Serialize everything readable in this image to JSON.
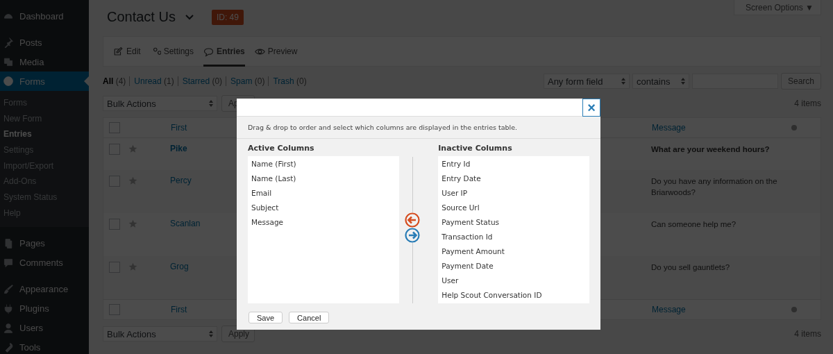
{
  "sidebar": {
    "groups": [
      [
        {
          "label": "Dashboard",
          "selected": false
        }
      ],
      [
        {
          "label": "Posts",
          "selected": false
        },
        {
          "label": "Media",
          "selected": false
        },
        {
          "label": "Forms",
          "selected": true,
          "children": [
            {
              "label": "Forms",
              "selected": false
            },
            {
              "label": "New Form",
              "selected": false
            },
            {
              "label": "Entries",
              "selected": true
            },
            {
              "label": "Settings",
              "selected": false
            },
            {
              "label": "Import/Export",
              "selected": false
            },
            {
              "label": "Add-Ons",
              "selected": false
            },
            {
              "label": "System Status",
              "selected": false
            },
            {
              "label": "Help",
              "selected": false
            }
          ]
        },
        {
          "label": "Pages",
          "selected": false
        },
        {
          "label": "Comments",
          "selected": false
        }
      ],
      [
        {
          "label": "Appearance",
          "selected": false
        },
        {
          "label": "Plugins",
          "selected": false
        },
        {
          "label": "Users",
          "selected": false
        },
        {
          "label": "Tools",
          "selected": false
        }
      ]
    ]
  },
  "screen_options": "Screen Options ▼",
  "header": {
    "title": "Contact Us",
    "badge": "ID: 49"
  },
  "tabs": [
    {
      "label": "Edit",
      "selected": false
    },
    {
      "label": "Settings",
      "selected": false
    },
    {
      "label": "Entries",
      "selected": true
    },
    {
      "label": "Preview",
      "selected": false
    }
  ],
  "filters": [
    {
      "label": "All",
      "count": "(4)",
      "selected": true
    },
    {
      "label": "Unread",
      "count": "(1)",
      "selected": false
    },
    {
      "label": "Starred",
      "count": "(0)",
      "selected": false
    },
    {
      "label": "Spam",
      "count": "(0)",
      "selected": false
    },
    {
      "label": "Trash",
      "count": "(0)",
      "selected": false
    }
  ],
  "search": {
    "field": "Any form field",
    "operator": "contains",
    "button": "Search"
  },
  "bulk_top": {
    "select": "Bulk Actions",
    "apply": "Ap"
  },
  "bulk_bottom": {
    "select": "Bulk Actions",
    "apply": "Apply"
  },
  "items_count_top": "4 items",
  "items_count_bottom": "4 items",
  "table": {
    "columns": [
      "First",
      "Message"
    ],
    "select_all_checked": false,
    "footer_select_all_checked": false,
    "rows": [
      {
        "first": "Pike",
        "message": "What are your weekend hours?",
        "unread": true,
        "starred": false,
        "checked": false
      },
      {
        "first": "Percy",
        "message": "Do you have any information on the Briarwoods?",
        "unread": false,
        "starred": false,
        "checked": false
      },
      {
        "first": "Scanlan",
        "message": "Can someone help me?",
        "unread": false,
        "starred": false,
        "checked": false
      },
      {
        "first": "Grog",
        "message": "Do you sell gauntlets?",
        "unread": false,
        "starred": false,
        "checked": false
      }
    ],
    "footer_columns": [
      "First",
      "Message"
    ]
  },
  "modal": {
    "close": "×",
    "description": "Drag & drop to order and select which columns are displayed in the entries table.",
    "active_title": "Active Columns",
    "active": [
      "Name (First)",
      "Name (Last)",
      "Email",
      "Subject",
      "Message"
    ],
    "inactive_title": "Inactive Columns",
    "inactive": [
      "Entry Id",
      "Entry Date",
      "User IP",
      "Source Url",
      "Payment Status",
      "Transaction Id",
      "Payment Amount",
      "Payment Date",
      "User",
      "Help Scout Conversation ID"
    ],
    "buttons": [
      "Save",
      "Cancel"
    ]
  }
}
